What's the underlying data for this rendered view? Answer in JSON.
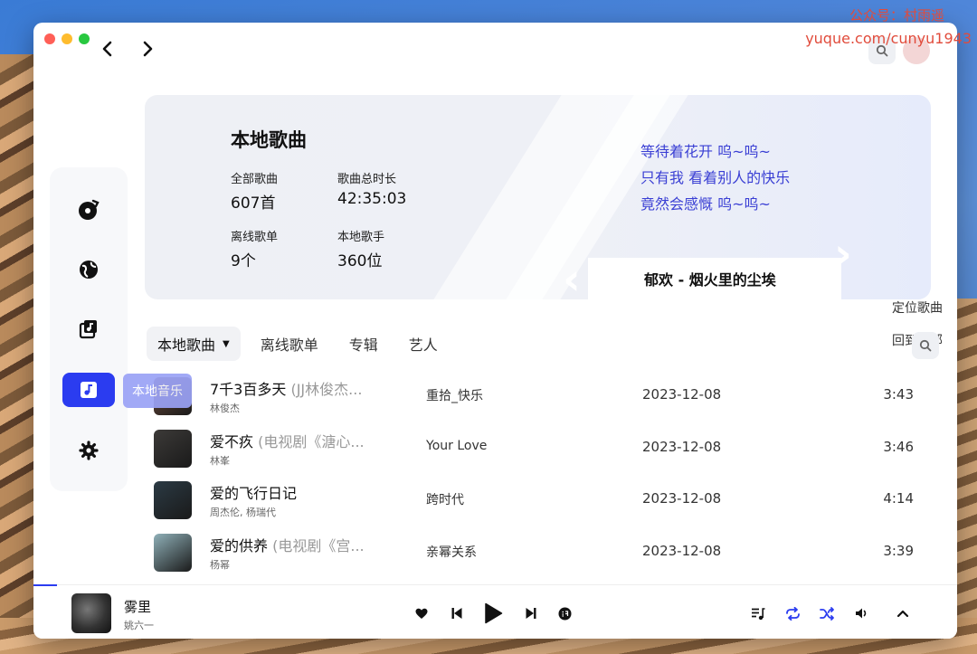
{
  "watermark": {
    "line1": "公众号：村雨遥",
    "line2": "yuque.com/cunyu1943"
  },
  "sidebar": {
    "items": [
      {
        "name": "music-disc-icon"
      },
      {
        "name": "globe-icon"
      },
      {
        "name": "playlist-icon"
      },
      {
        "name": "music-note-icon"
      },
      {
        "name": "gear-icon"
      }
    ],
    "active_tooltip": "本地音乐"
  },
  "hero": {
    "title": "本地歌曲",
    "stats": [
      {
        "label": "全部歌曲",
        "value": "607首"
      },
      {
        "label": "歌曲总时长",
        "value": "42:35:03"
      },
      {
        "label": "离线歌单",
        "value": "9个"
      },
      {
        "label": "本地歌手",
        "value": "360位"
      }
    ],
    "lyrics": [
      "等待着花开 呜~呜~",
      "只有我 看着别人的快乐",
      "竟然会感慨 呜~呜~"
    ],
    "now_song": "郁欢 - 烟火里的尘埃"
  },
  "right_actions": {
    "locate": "定位歌曲",
    "back_to_top": "回到顶部"
  },
  "tabs": [
    "本地歌曲",
    "离线歌单",
    "专辑",
    "艺人"
  ],
  "songs": [
    {
      "title": "7千3百多天",
      "subtitle": "(JJ林俊杰...",
      "artist": "林俊杰",
      "album": "重拾_快乐",
      "date": "2023-12-08",
      "duration": "3:43",
      "cover_color": "#6d4a3a"
    },
    {
      "title": "爱不疚",
      "subtitle": "(电视剧《溏心...",
      "artist": "林峯",
      "album": "Your Love",
      "date": "2023-12-08",
      "duration": "3:46",
      "cover_color": "#3c3a38"
    },
    {
      "title": "爱的飞行日记",
      "subtitle": "",
      "artist": "周杰伦, 杨瑞代",
      "album": "跨时代",
      "date": "2023-12-08",
      "duration": "4:14",
      "cover_color": "#2b3a44"
    },
    {
      "title": "爱的供养",
      "subtitle": "(电视剧《宫...",
      "artist": "杨幂",
      "album": "亲幂关系",
      "date": "2023-12-08",
      "duration": "3:39",
      "cover_color": "#8fb0b8"
    }
  ],
  "player": {
    "title": "雾里",
    "artist": "姚六一",
    "progress": 0.025
  },
  "colors": {
    "accent": "#2b3cf0",
    "lyric": "#3a3fd4"
  }
}
